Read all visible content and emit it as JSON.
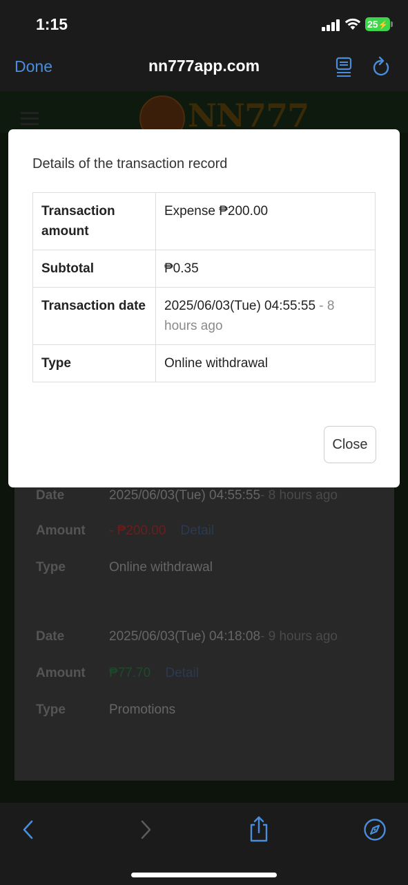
{
  "status_bar": {
    "time": "1:15",
    "battery": "25",
    "icons": [
      "signal-icon",
      "wifi-icon",
      "battery-icon"
    ]
  },
  "browser": {
    "done_label": "Done",
    "url": "nn777app.com",
    "icons": [
      "reader-icon",
      "reload-icon"
    ]
  },
  "background_page": {
    "logo_text": "NN777",
    "records": [
      {
        "date_label": "Date",
        "date": "2025/06/03(Tue) 04:55:55",
        "date_ago": "- 8 hours ago",
        "amount_label": "Amount",
        "amount": "- ₱200.00",
        "detail_label": "Detail",
        "type_label": "Type",
        "type": "Online withdrawal"
      },
      {
        "date_label": "Date",
        "date": "2025/06/03(Tue) 04:18:08",
        "date_ago": "- 9 hours ago",
        "amount_label": "Amount",
        "amount": "₱77.70",
        "detail_label": "Detail",
        "type_label": "Type",
        "type": "Promotions"
      }
    ]
  },
  "modal": {
    "title": "Details of the transaction record",
    "rows": [
      {
        "label": "Transaction amount",
        "value": "Expense ₱200.00"
      },
      {
        "label": "Subtotal",
        "value": "₱0.35"
      },
      {
        "label": "Transaction date",
        "value": "2025/06/03(Tue) 04:55:55",
        "value_suffix": " - 8 hours ago"
      },
      {
        "label": "Type",
        "value": "Online withdrawal"
      }
    ],
    "close_label": "Close"
  },
  "toolbar": {
    "icons": [
      "back-icon",
      "forward-icon",
      "share-icon",
      "compass-icon"
    ]
  },
  "colors": {
    "link_blue": "#4a8edb",
    "expense_red": "#d93a3a",
    "battery_green": "#3dd54a"
  }
}
